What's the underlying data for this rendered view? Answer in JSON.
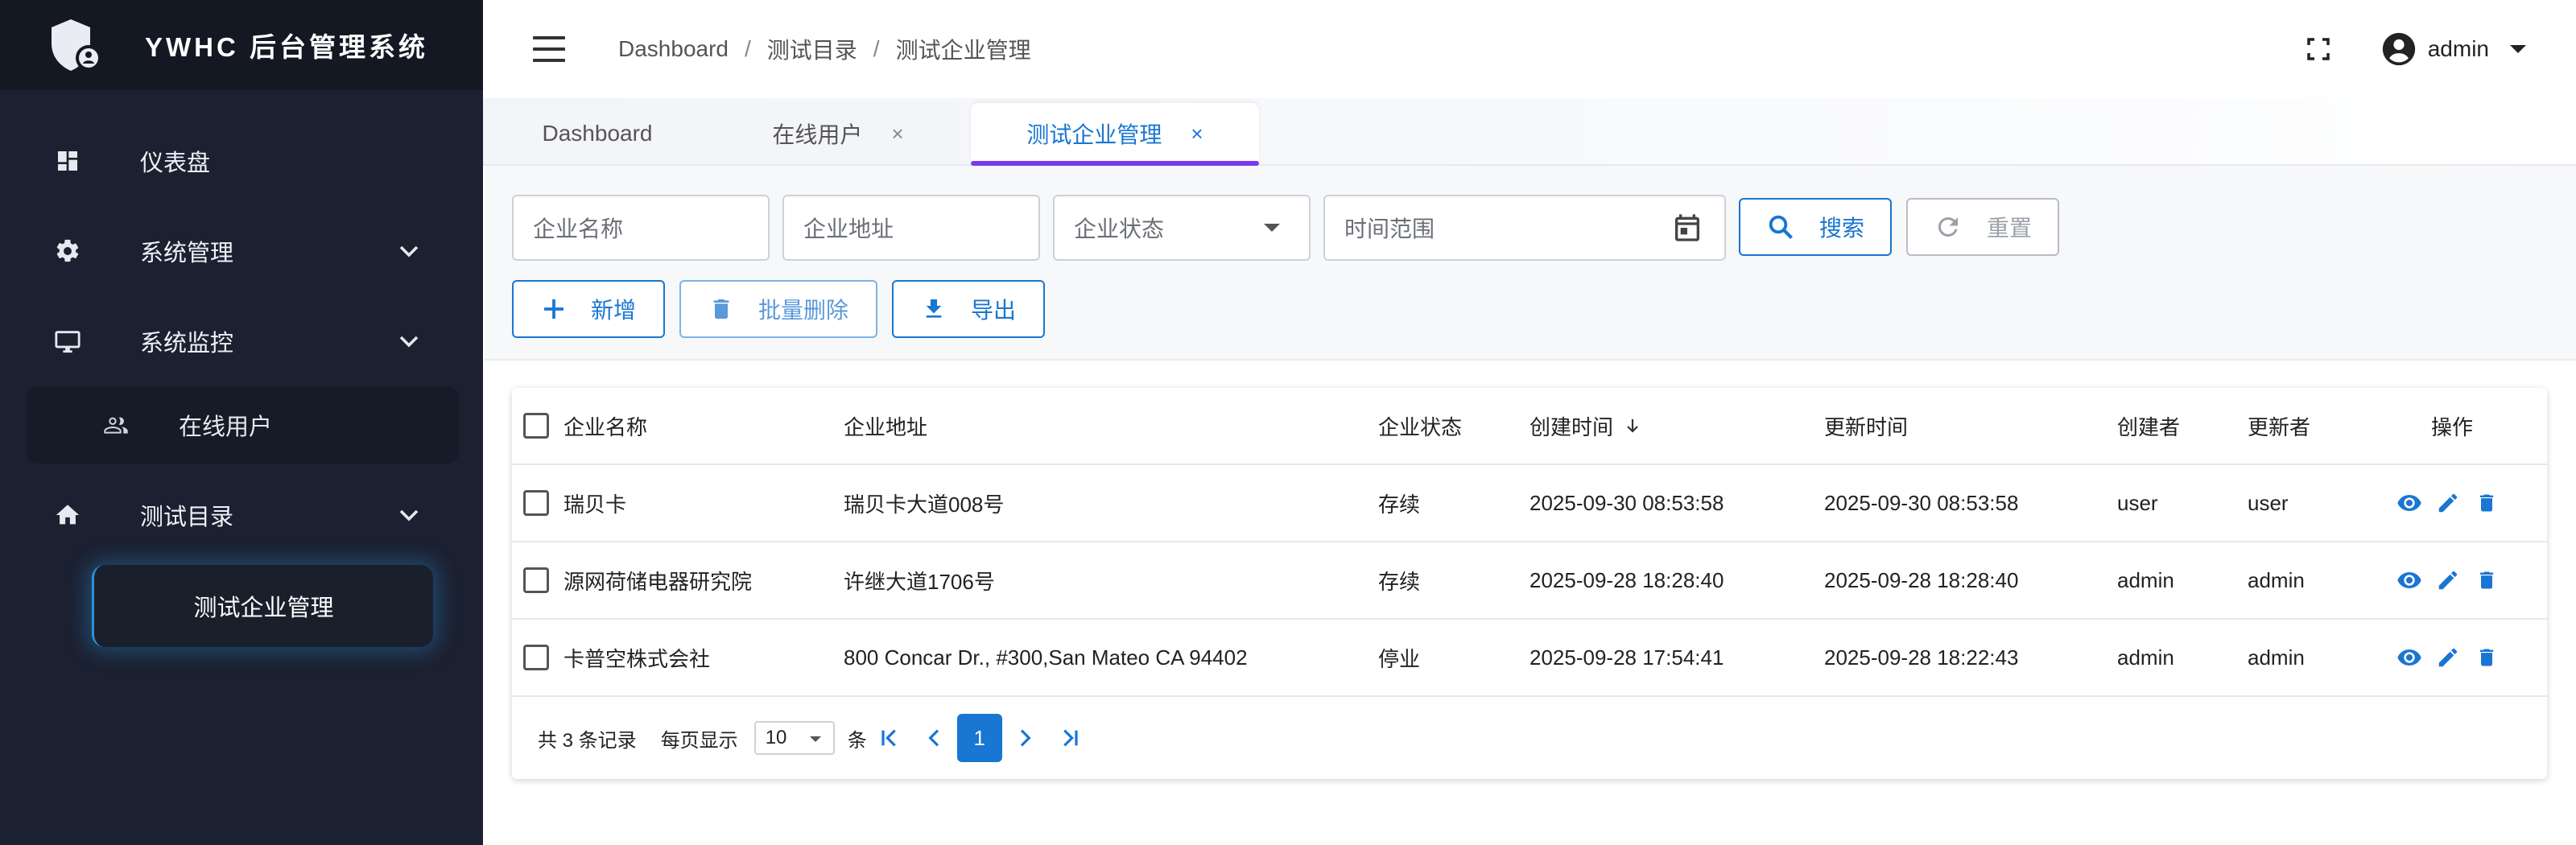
{
  "app": {
    "title": "YWHC 后台管理系统"
  },
  "sidebar": {
    "items": [
      {
        "label": "仪表盘",
        "icon": "dashboard-icon"
      },
      {
        "label": "系统管理",
        "icon": "gear-icon"
      },
      {
        "label": "系统监控",
        "icon": "monitor-icon"
      },
      {
        "label": "在线用户",
        "icon": "people-icon"
      },
      {
        "label": "测试目录",
        "icon": "home-icon"
      },
      {
        "label": "测试企业管理"
      }
    ]
  },
  "header": {
    "breadcrumb": [
      "Dashboard",
      "测试目录",
      "测试企业管理"
    ],
    "separator": "/",
    "user": "admin"
  },
  "tabs": [
    {
      "label": "Dashboard"
    },
    {
      "label": "在线用户",
      "close": "×"
    },
    {
      "label": "测试企业管理",
      "close": "×",
      "active": true
    }
  ],
  "filters": {
    "name_placeholder": "企业名称",
    "address_placeholder": "企业地址",
    "status_placeholder": "企业状态",
    "time_placeholder": "时间范围",
    "search_label": "搜索",
    "reset_label": "重置"
  },
  "toolbar": {
    "add_label": "新增",
    "batch_delete_label": "批量删除",
    "export_label": "导出"
  },
  "table": {
    "columns": [
      "企业名称",
      "企业地址",
      "企业状态",
      "创建时间",
      "更新时间",
      "创建者",
      "更新者",
      "操作"
    ],
    "rows": [
      {
        "name": "瑞贝卡",
        "address": "瑞贝卡大道008号",
        "status": "存续",
        "created": "2025-09-30 08:53:58",
        "updated": "2025-09-30 08:53:58",
        "creator": "user",
        "updater": "user"
      },
      {
        "name": "源网荷储电器研究院",
        "address": "许继大道1706号",
        "status": "存续",
        "created": "2025-09-28 18:28:40",
        "updated": "2025-09-28 18:28:40",
        "creator": "admin",
        "updater": "admin"
      },
      {
        "name": "卡普空株式会社",
        "address": "800 Concar Dr., #300,San Mateo CA 94402",
        "status": "停业",
        "created": "2025-09-28 17:54:41",
        "updated": "2025-09-28 18:22:43",
        "creator": "admin",
        "updater": "admin"
      }
    ]
  },
  "pager": {
    "total_text": "共 3 条记录",
    "per_page_label": "每页显示",
    "per_page_value": "10",
    "unit": "条",
    "current_page": "1"
  },
  "colors": {
    "primary": "#1976d2",
    "sidebar_bg": "#1c2131",
    "brand_bg": "#141823",
    "tab_indicator": "#7c3aed"
  }
}
